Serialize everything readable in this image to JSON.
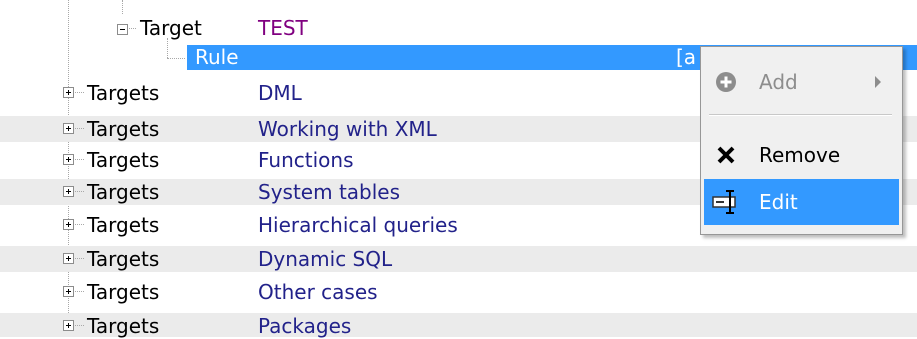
{
  "tree": {
    "target_label": "Target",
    "target_value": "TEST",
    "rule_label": "Rule",
    "rule_value": "[a",
    "rows": [
      {
        "label": "Targets",
        "value": "DML"
      },
      {
        "label": "Targets",
        "value": "Working with XML"
      },
      {
        "label": "Targets",
        "value": "Functions"
      },
      {
        "label": "Targets",
        "value": "System tables"
      },
      {
        "label": "Targets",
        "value": "Hierarchical queries"
      },
      {
        "label": "Targets",
        "value": "Dynamic SQL"
      },
      {
        "label": "Targets",
        "value": "Other cases"
      },
      {
        "label": "Targets",
        "value": "Packages"
      }
    ]
  },
  "context_menu": {
    "add_label": "Add",
    "remove_label": "Remove",
    "edit_label": "Edit",
    "add_enabled": false,
    "highlighted": "Edit",
    "add_icon": "plus-circle-icon",
    "remove_icon": "x-icon",
    "edit_icon": "text-cursor-edit-icon"
  },
  "colors": {
    "selection": "#3399ff",
    "alt_row": "#ebebeb",
    "value_text": "#22228a",
    "target_value_text": "#800080"
  }
}
